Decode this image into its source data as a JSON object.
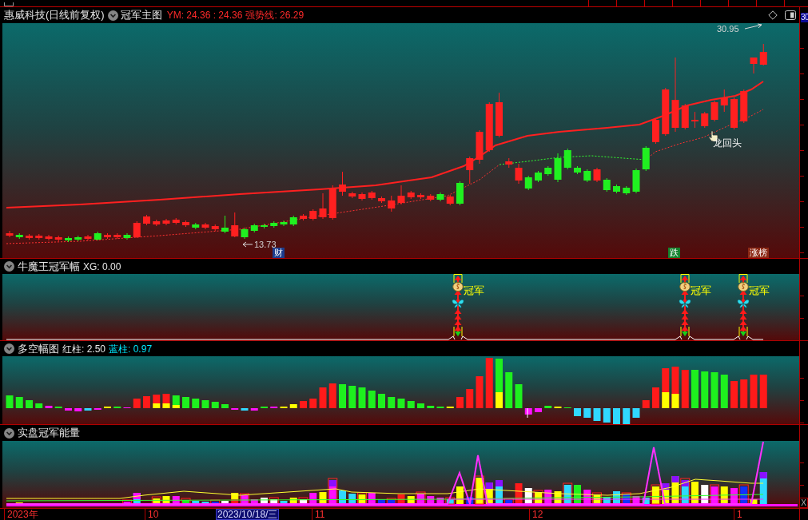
{
  "quote_header": {
    "title": "惠威科技(日线前复权)",
    "indicator": "冠军主图",
    "readings": [
      {
        "text": "YM: 24.36 : 24.36",
        "color": "#ff2a2a"
      },
      {
        "text": "强势线: 26.29",
        "color": "#ff2a2a"
      }
    ],
    "axis_label": "30"
  },
  "main_chart": {
    "high_label": "30.95",
    "low_label": "13.73",
    "signal_label": "龙回头",
    "event_tags": [
      {
        "text": "财",
        "color": "#1c3c8c"
      },
      {
        "text": "跌",
        "color": "#13822c"
      },
      {
        "text": "涨榜",
        "color": "#8c2814"
      }
    ]
  },
  "panels": [
    {
      "kind": "signals",
      "title": "牛魔王冠军幅",
      "readings": [
        {
          "text": "XG: 0.00",
          "color": "#e8e8e8"
        }
      ],
      "signals": [
        {
          "label": "冠军"
        },
        {
          "label": "冠军"
        },
        {
          "label": "冠军"
        }
      ]
    },
    {
      "kind": "histogram",
      "title": "多空幅图",
      "readings": [
        {
          "text": "红柱: 2.50",
          "color": "#e8e8e8"
        },
        {
          "text": "蓝柱: 0.97",
          "color": "#00e8ff"
        }
      ]
    },
    {
      "kind": "energy",
      "title": "实盘冠军能量"
    }
  ],
  "x_axis": {
    "labels": [
      {
        "text": "2023年",
        "kind": "tick"
      },
      {
        "text": "10",
        "kind": "tick"
      },
      {
        "text": "2023/10/18/三",
        "kind": "cursor"
      },
      {
        "text": "11",
        "kind": "tick"
      },
      {
        "text": "12",
        "kind": "tick"
      },
      {
        "text": "1",
        "kind": "tick"
      }
    ],
    "corner": "X"
  }
}
